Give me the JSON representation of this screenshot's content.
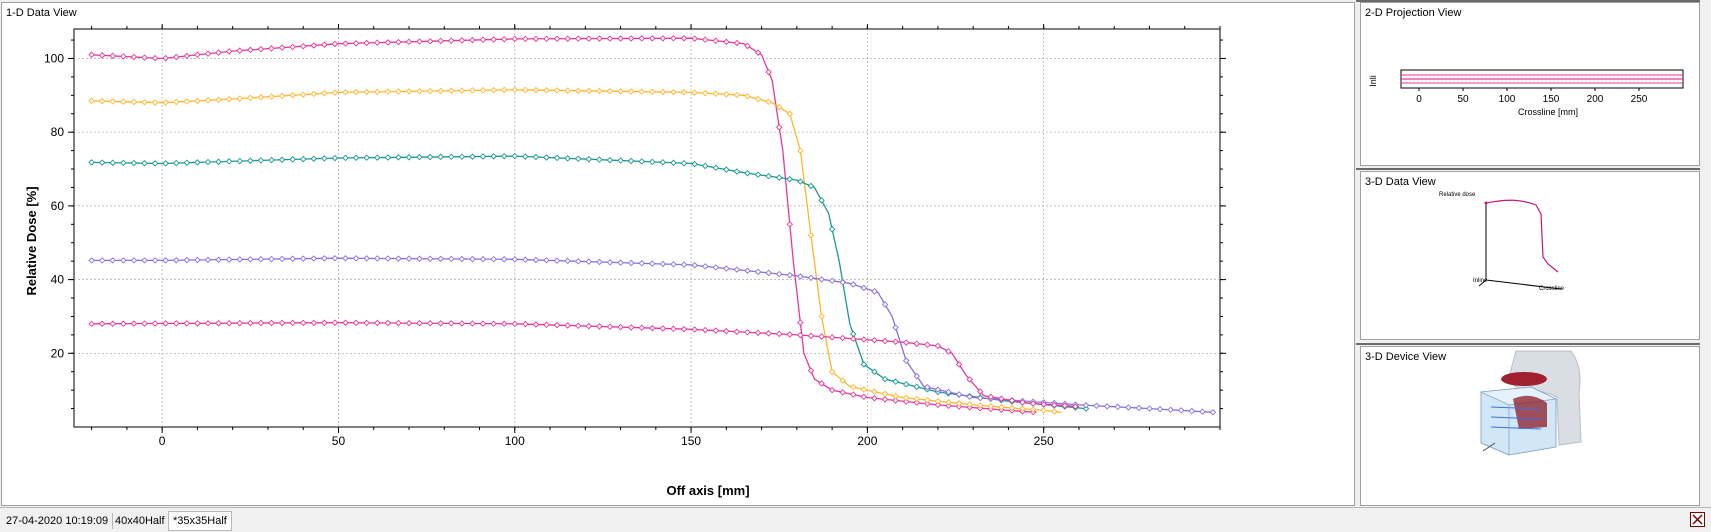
{
  "panels": {
    "main_title": "1-D Data View",
    "projection_title": "2-D Projection View",
    "data3d_title": "3-D Data View",
    "device_title": "3-D Device View"
  },
  "projection": {
    "xlabel": "Crossline [mm]",
    "ylabel": "Inli",
    "ticks": [
      "0",
      "50",
      "100",
      "150",
      "200",
      "250"
    ]
  },
  "data3d": {
    "zlabel": "Relative dose",
    "xlabel": "Crossline",
    "ylabel": "Inline"
  },
  "status": {
    "timestamp": "27-04-2020 10:19:09",
    "tab1": "40x40Half",
    "tab2": "*35x35Half"
  },
  "colors": {
    "magenta": "#e6399b",
    "orange": "#ffb52e",
    "teal": "#1a9990",
    "purple": "#8a6fe0"
  },
  "chart_data": {
    "type": "line",
    "xlabel": "Off axis [mm]",
    "ylabel": "Relative Dose [%]",
    "xlim": [
      -25,
      300
    ],
    "ylim": [
      0,
      108
    ],
    "x_ticks": [
      0,
      50,
      100,
      150,
      200,
      250
    ],
    "y_ticks": [
      20,
      40,
      60,
      80,
      100
    ],
    "grid": true,
    "series": [
      {
        "color": "#e6399b",
        "points": [
          [
            -20,
            101
          ],
          [
            0,
            100
          ],
          [
            20,
            102
          ],
          [
            50,
            104
          ],
          [
            100,
            105.3
          ],
          [
            150,
            105.5
          ],
          [
            165,
            104
          ],
          [
            170,
            101
          ],
          [
            173,
            94
          ],
          [
            176,
            75
          ],
          [
            179,
            45
          ],
          [
            182,
            20
          ],
          [
            185,
            13
          ],
          [
            190,
            10
          ],
          [
            200,
            8
          ],
          [
            220,
            6
          ],
          [
            240,
            4.5
          ],
          [
            248,
            4
          ]
        ]
      },
      {
        "color": "#ffb52e",
        "points": [
          [
            -20,
            88.5
          ],
          [
            0,
            88
          ],
          [
            20,
            89
          ],
          [
            50,
            90.8
          ],
          [
            100,
            91.5
          ],
          [
            150,
            90.8
          ],
          [
            165,
            90
          ],
          [
            173,
            88
          ],
          [
            178,
            85
          ],
          [
            181,
            75
          ],
          [
            184,
            52
          ],
          [
            187,
            30
          ],
          [
            190,
            15
          ],
          [
            195,
            11
          ],
          [
            210,
            8
          ],
          [
            230,
            6
          ],
          [
            250,
            4.5
          ],
          [
            255,
            4
          ]
        ]
      },
      {
        "color": "#1a9990",
        "points": [
          [
            -20,
            71.8
          ],
          [
            0,
            71.5
          ],
          [
            50,
            73
          ],
          [
            100,
            73.5
          ],
          [
            150,
            71.5
          ],
          [
            165,
            69
          ],
          [
            180,
            67
          ],
          [
            185,
            65
          ],
          [
            189,
            58
          ],
          [
            192,
            45
          ],
          [
            195,
            28
          ],
          [
            199,
            17
          ],
          [
            205,
            13
          ],
          [
            220,
            9.5
          ],
          [
            240,
            7
          ],
          [
            262,
            5
          ]
        ]
      },
      {
        "color": "#8a6fe0",
        "points": [
          [
            -20,
            45.2
          ],
          [
            0,
            45.2
          ],
          [
            50,
            45.8
          ],
          [
            100,
            45.5
          ],
          [
            150,
            44
          ],
          [
            180,
            41
          ],
          [
            195,
            39
          ],
          [
            203,
            36.5
          ],
          [
            207,
            30
          ],
          [
            211,
            18
          ],
          [
            216,
            11
          ],
          [
            230,
            8
          ],
          [
            260,
            6
          ],
          [
            280,
            5
          ],
          [
            298,
            4
          ]
        ]
      },
      {
        "color": "#e6399b",
        "points": [
          [
            -20,
            28
          ],
          [
            50,
            28.3
          ],
          [
            100,
            28
          ],
          [
            150,
            26.5
          ],
          [
            180,
            25
          ],
          [
            210,
            23
          ],
          [
            220,
            22
          ],
          [
            224,
            20
          ],
          [
            228,
            14
          ],
          [
            233,
            8.5
          ],
          [
            245,
            6.5
          ],
          [
            260,
            5.5
          ]
        ]
      }
    ]
  }
}
